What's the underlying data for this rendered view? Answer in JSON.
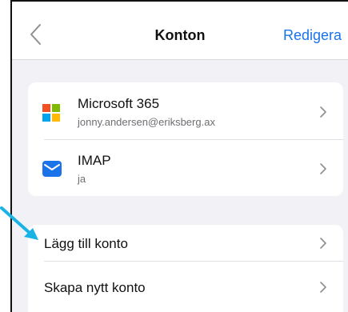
{
  "navbar": {
    "back_icon": "chevron-left-icon",
    "title": "Konton",
    "edit_label": "Redigera"
  },
  "accounts": [
    {
      "name": "Microsoft 365",
      "email": "jonny.andersen@eriksberg.ax",
      "icon": "microsoft-logo-icon"
    },
    {
      "name": "IMAP",
      "email": "ja",
      "icon": "mail-icon"
    }
  ],
  "actions": {
    "add_account": "Lägg till konto",
    "create_account": "Skapa nytt konto"
  },
  "colors": {
    "accent": "#1a73e8",
    "background": "#f2f2f6",
    "pointer": "#1ab3e6"
  }
}
